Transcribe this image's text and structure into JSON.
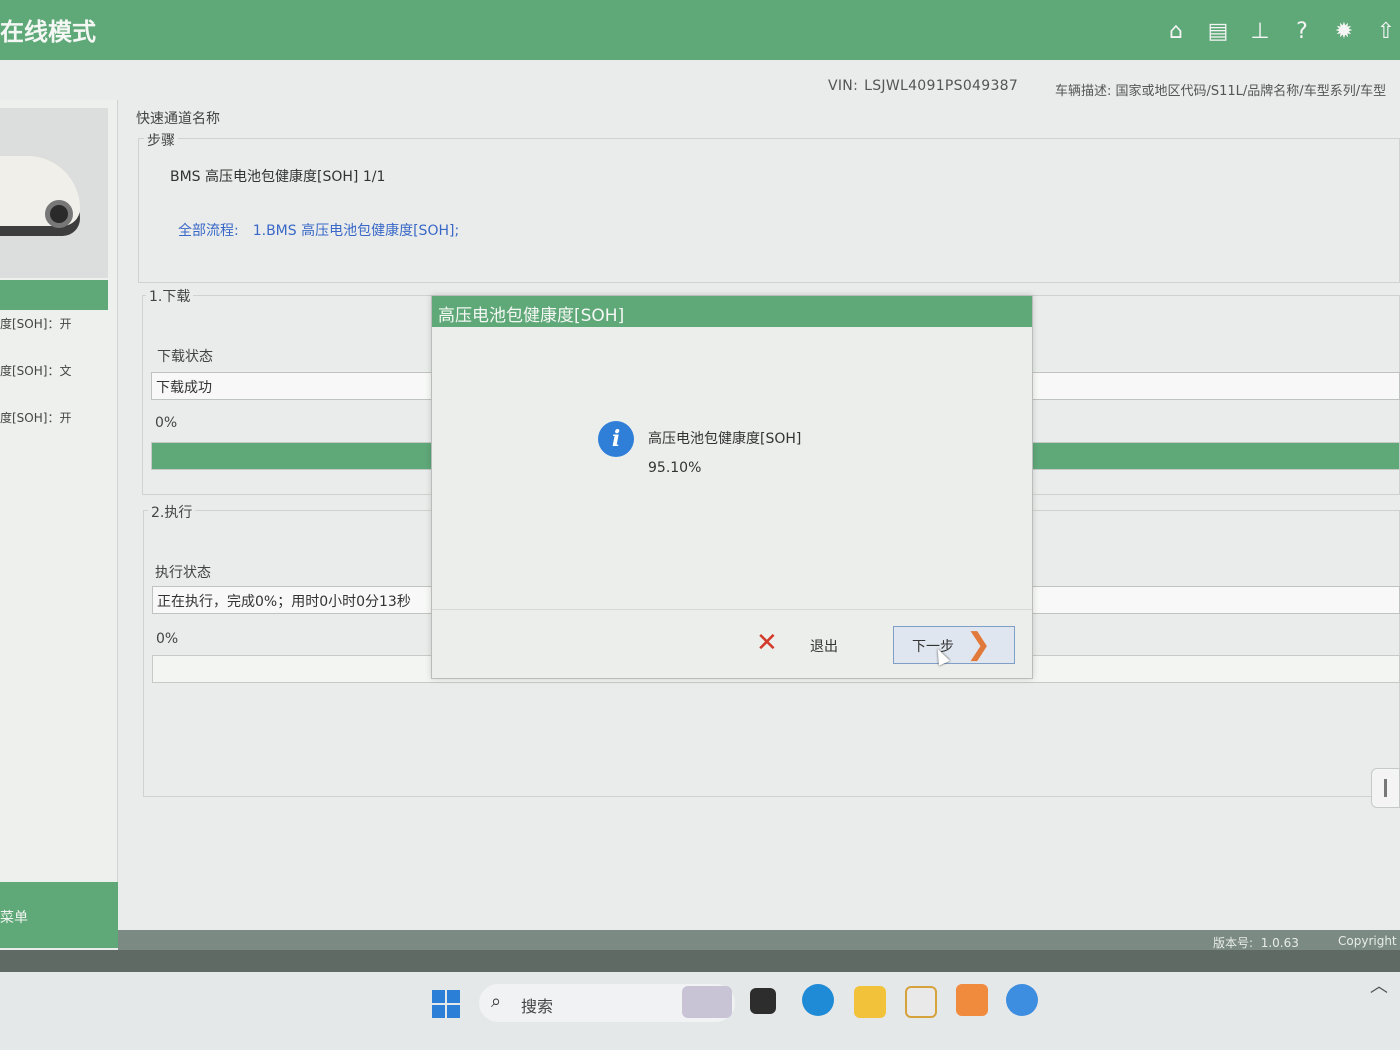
{
  "app": {
    "title": "在线模式"
  },
  "header": {
    "vin_label": "VIN:",
    "vin_value": "LSJWL4091PS049387",
    "vehicle_desc": "车辆描述:  国家或地区代码/S11L/品牌名称/车型系列/车型"
  },
  "sidebar": {
    "items": [
      "度[SOH]：开",
      "度[SOH]：文",
      "度[SOH]：开"
    ],
    "bottom_label": "菜单"
  },
  "main": {
    "quick_channel_label": "快速通道名称",
    "steps_legend": "步骤",
    "step_title": "BMS 高压电池包健康度[SOH] 1/1",
    "all_flow_label": "全部流程:",
    "all_flow_value": "1.BMS 高压电池包健康度[SOH];",
    "download": {
      "legend": "1.下载",
      "status_label": "下载状态",
      "status_value": "下载成功",
      "percent_text": "0%",
      "progress_fraction": 1.0
    },
    "execute": {
      "legend": "2.执行",
      "status_label": "执行状态",
      "status_value": "正在执行，完成0%；用时0小时0分13秒",
      "percent_text": "0%",
      "progress_fraction": 0.0
    }
  },
  "dialog": {
    "title": "高压电池包健康度[SOH]",
    "message_title": "高压电池包健康度[SOH]",
    "message_value": "95.10%",
    "exit_label": "退出",
    "next_label": "下一步"
  },
  "footer": {
    "version_label": "版本号:",
    "version_value": "1.0.63",
    "copyright": "Copyright"
  },
  "taskbar": {
    "search_placeholder": "搜索"
  },
  "colors": {
    "accent_green": "#5fa878",
    "link_blue": "#3a68c8",
    "info_blue": "#2f7fd9",
    "exit_red": "#d23b2b",
    "next_orange": "#e0793a"
  }
}
